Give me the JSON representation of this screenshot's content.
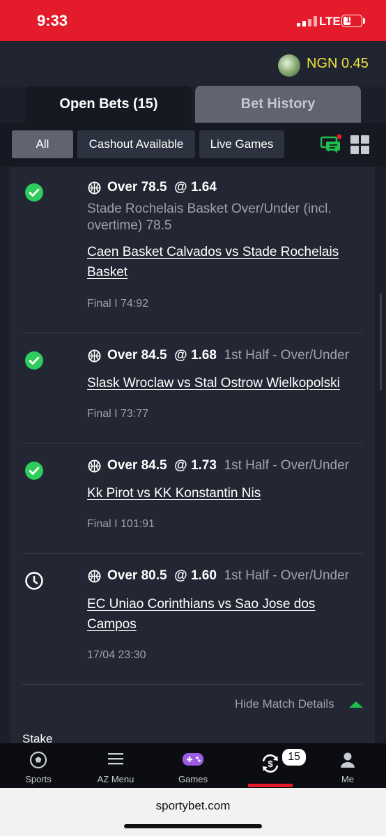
{
  "status_bar": {
    "time": "9:33",
    "network": "LTE",
    "battery": "14"
  },
  "header": {
    "balance": "NGN 0.45"
  },
  "tabs": {
    "open_bets": "Open Bets (15)",
    "bet_history": "Bet History"
  },
  "filters": {
    "all": "All",
    "cashout": "Cashout Available",
    "live": "Live Games"
  },
  "bets": [
    {
      "status": "won",
      "selection": "Over 78.5",
      "odds": "@ 1.64",
      "extra": "",
      "market": "Stade Rochelais Basket Over/Under (incl. overtime) 78.5",
      "match": "Caen Basket Calvados vs Stade Rochelais Basket",
      "result": "Final  I 74:92"
    },
    {
      "status": "won",
      "selection": "Over 84.5",
      "odds": "@ 1.68",
      "extra": "1st Half - Over/Under",
      "market": "",
      "match": "Slask Wroclaw vs Stal Ostrow Wielkopolski",
      "result": "Final  I 73:77"
    },
    {
      "status": "won",
      "selection": "Over 84.5",
      "odds": "@ 1.73",
      "extra": "1st Half - Over/Under",
      "market": "",
      "match": "Kk Pirot vs KK Konstantin Nis",
      "result": "Final  I 101:91"
    },
    {
      "status": "pending",
      "selection": "Over 80.5",
      "odds": "@ 1.60",
      "extra": "1st Half - Over/Under",
      "market": "",
      "match": "EC Uniao Corinthians vs Sao Jose dos Campos",
      "result": "17/04 23:30"
    }
  ],
  "details": {
    "hide_label": "Hide Match Details",
    "stake_label": "Stake"
  },
  "nav": {
    "sports": "Sports",
    "az_menu": "AZ Menu",
    "games": "Games",
    "open_bets_count": "15",
    "me": "Me"
  },
  "browser": {
    "url": "sportybet.com"
  },
  "colors": {
    "brand_red": "#e41b2a",
    "won_green": "#2ecc5a",
    "balance_yellow": "#f2e23a"
  }
}
